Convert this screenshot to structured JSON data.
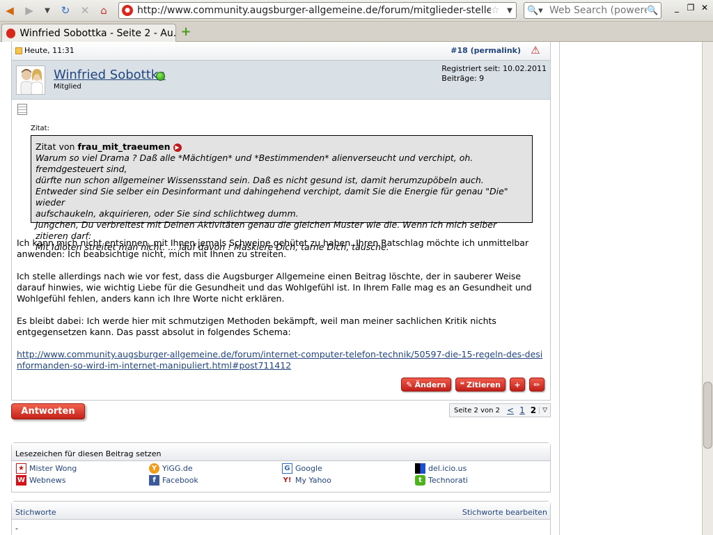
{
  "browser": {
    "url": "http://www.community.augsburger-allgemeine.de/forum/mitglieder-stellen-sic",
    "search_placeholder": "Web Search (powered",
    "tab_title": "Winfried Sobottka - Seite 2 - Au..."
  },
  "post": {
    "date": "Heute, 11:31",
    "permalink": "#18 (permalink)",
    "username": "Winfried Sobottka",
    "role": "Mitglied",
    "registered": "Registriert seit: 10.02.2011",
    "posts": "Beiträge: 9",
    "quote_label": "Zitat:",
    "quote_prefix": "Zitat von",
    "quote_author": "frau_mit_traeumen",
    "quote_lines": [
      "Warum so viel Drama ? Daß alle *Mächtigen* und *Bestimmenden* alienverseucht und verchipt, oh. fremdgesteuert sind,",
      "dürfte nun schon allgemeiner Wissensstand sein. Daß es nicht gesund ist, damit herumzupöbeln auch.",
      "Entweder sind Sie selber ein Desinformant und dahingehend verchipt, damit Sie die Energie für genau \"Die\" wieder",
      "aufschaukeln, akquirieren, oder Sie sind schlichtweg dumm.",
      "Jungchen, Du verbreitest mit Deinen Aktivitäten genau die gleichen Muster wie die. Wenn ich mich selber zitieren darf:",
      "Mit Idioten streitet man nicht. ... lauf davon ! Maskiere Dich, tarne Dich, täusche."
    ],
    "para1": "Ich kann mich nicht entsinnen, mit Ihnen jemals Schweine gehütet zu haben. Ihren Ratschlag möchte ich unmittelbar anwenden: Ich beabsichtige nicht, mich mit Ihnen zu streiten.",
    "para2": "Ich stelle allerdings nach wie vor fest, dass die Augsburger Allgemeine einen Beitrag löschte, der in sauberer Weise darauf hinwies, wie wichtig Liebe für die Gesundheit und das Wohlgefühl ist. In Ihrem Falle mag es an Gesundheit und Wohlgefühl fehlen, anders kann ich Ihre Worte nicht erklären.",
    "para3": "Es bleibt dabei: Ich werde hier mit schmutzigen Methoden bekämpft, weil man meiner sachlichen Kritik nichts entgegensetzen kann. Das passt absolut in folgendes Schema:",
    "link": "http://www.community.augsburger-allgemeine.de/forum/internet-computer-telefon-technik/50597-die-15-regeln-des-desinformanden-so-wird-im-internet-manipuliert.html#post711412",
    "edit_label": "Ändern",
    "quote_button_label": "Zitieren"
  },
  "reply": {
    "button": "Antworten",
    "page_label": "Seite 2 von 2",
    "prev": "<",
    "page1": "1",
    "page2": "2"
  },
  "bookmarks": {
    "title": "Lesezeichen für diesen Beitrag setzen",
    "items": [
      "Mister Wong",
      "YiGG.de",
      "Google",
      "del.icio.us",
      "Webnews",
      "Facebook",
      "My Yahoo",
      "Technorati"
    ]
  },
  "tags": {
    "title": "Stichworte",
    "edit": "Stichworte bearbeiten",
    "value": "-"
  },
  "colors": {
    "link": "#22457f",
    "button_red": "#c1201a",
    "userbar": "#d9e1e6"
  }
}
